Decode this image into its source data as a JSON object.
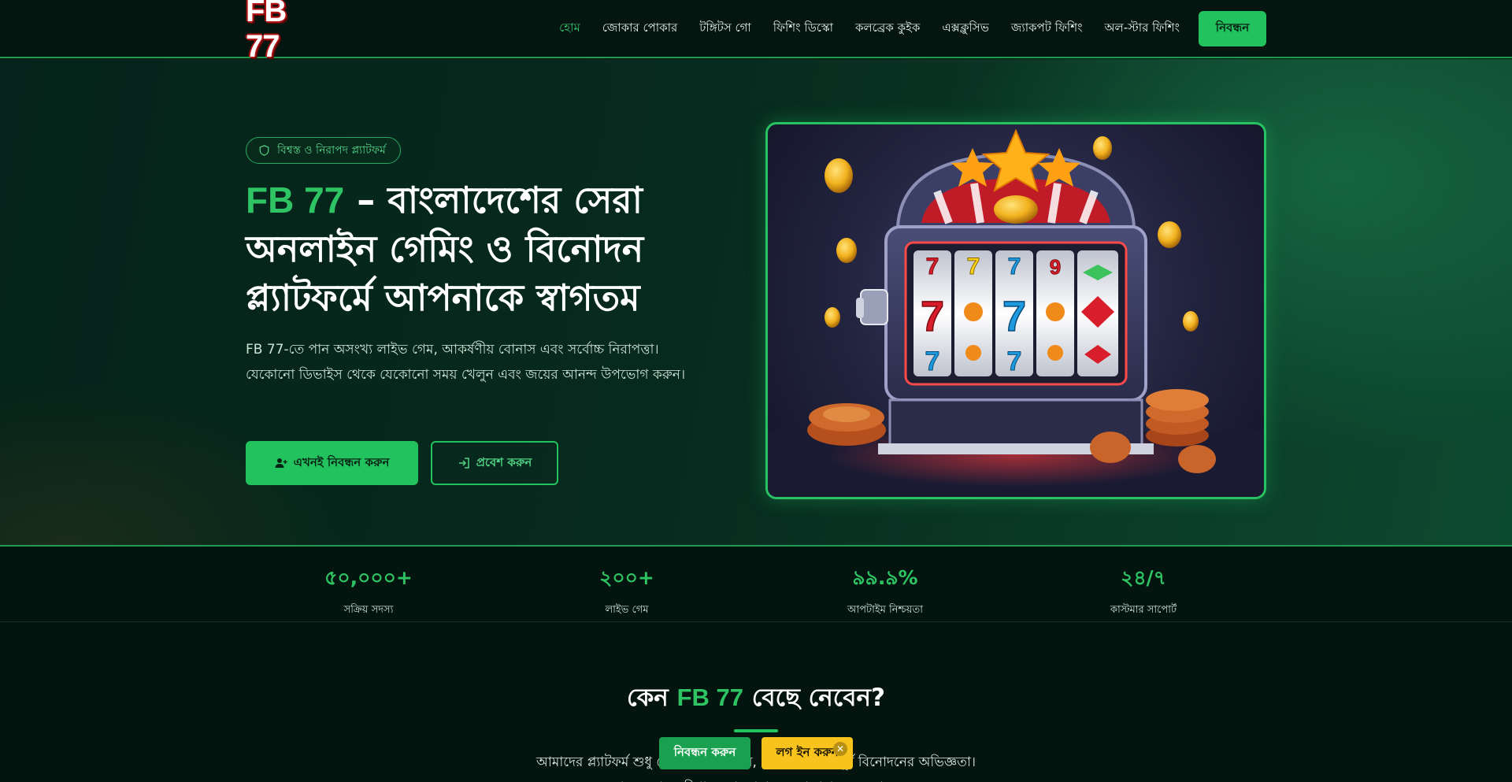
{
  "header": {
    "logo": "FB 77",
    "nav": [
      "হোম",
      "জোকার পোকার",
      "টঙ্গিটস গো",
      "ফিশিং ডিস্কো",
      "কলব্রেক কুইক",
      "এক্সক্লুসিভ",
      "জ্যাকপট ফিশিং",
      "অল-স্টার ফিশিং"
    ],
    "cta": "নিবন্ধন"
  },
  "hero": {
    "badge": "বিশ্বস্ত ও নিরাপদ প্ল্যাটফর্ম",
    "title_brand": "FB 77",
    "title_rest": " – বাংলাদেশের সেরা অনলাইন গেমিং ও বিনোদন প্ল্যাটফর্মে আপনাকে স্বাগতম",
    "description": "FB 77-তে পান অসংখ্য লাইভ গেম, আকর্ষণীয় বোনাস এবং সর্বোচ্চ নিরাপত্তা। যেকোনো ডিভাইস থেকে যেকোনো সময় খেলুন এবং জয়ের আনন্দ উপভোগ করুন।",
    "primary_button": "এখনই নিবন্ধন করুন",
    "secondary_button": "প্রবেশ করুন"
  },
  "stats": [
    {
      "value": "৫০,০০০+",
      "label": "সক্রিয় সদস্য"
    },
    {
      "value": "২০০+",
      "label": "লাইভ গেম"
    },
    {
      "value": "৯৯.৯%",
      "label": "আপটাইম নিশ্চয়তা"
    },
    {
      "value": "২৪/৭",
      "label": "কাস্টমার সাপোর্ট"
    }
  ],
  "why": {
    "title_prefix": "কেন ",
    "title_brand": "FB 77",
    "title_suffix": " বেছে নেবেন?",
    "description": "আমাদের প্ল্যাটফর্ম শুধু খেলার জায়গা নয়, এটি একটি সম্পূর্ণ বিনোদনের অভিজ্ঞতা। জানুন কোন সুবিধাগুলো আমাদের আলাদা করে তোলে।"
  },
  "floating_bar": {
    "register": "নিবন্ধন করুন",
    "login": "লগ ইন করুন",
    "close": "✕"
  },
  "slot_symbols": {
    "row1": [
      "7",
      "7",
      "7",
      "9"
    ],
    "row2": [
      "7",
      "7"
    ],
    "row3": [
      "7",
      "7"
    ]
  },
  "colors": {
    "accent": "#22c25e",
    "brand_text": "#2fc463",
    "background": "#04140f",
    "login_yellow": "#f7c31c"
  }
}
